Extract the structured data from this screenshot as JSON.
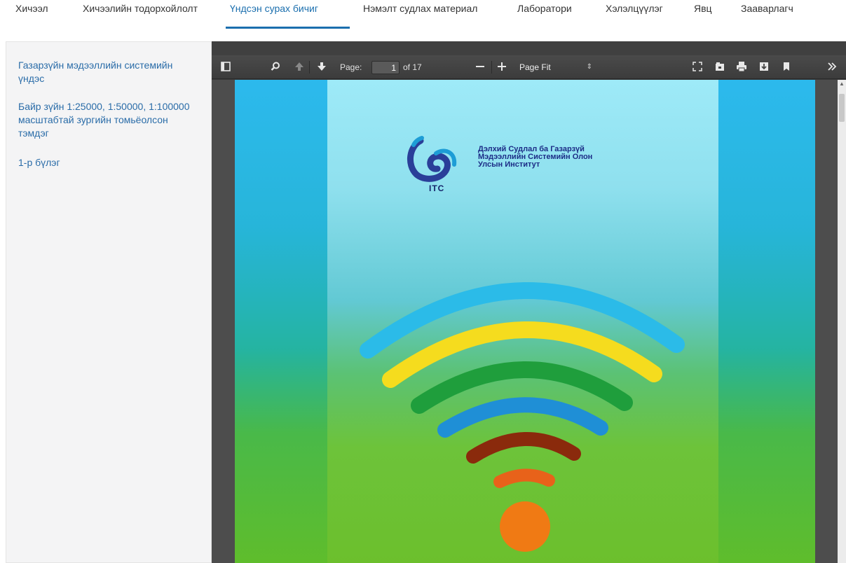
{
  "nav": {
    "tabs": [
      {
        "label": "Хичээл"
      },
      {
        "label": "Хичээлийн тодорхойлолт"
      },
      {
        "label": "Үндсэн сурах бичиг"
      },
      {
        "label": "Нэмэлт судлах материал"
      },
      {
        "label": "Лаборатори"
      },
      {
        "label": "Хэлэлцүүлэг"
      },
      {
        "label": "Явц"
      },
      {
        "label": "Зааварлагч"
      }
    ],
    "active_tab": "Үндсэн сурах бичиг"
  },
  "sidebar": {
    "items": [
      {
        "label": "Газарзүйн мэдээллийн системийн үндэс"
      },
      {
        "label": "Байр зүйн 1:25000, 1:50000, 1:100000 масштабтай зургийн томьёолсон тэмдэг"
      },
      {
        "label": "1-р бүлэг"
      }
    ]
  },
  "viewer": {
    "page_label": "Page:",
    "page_value": "1",
    "page_total": "of 17",
    "zoom_value": "Page Fit",
    "icons": [
      "sidebar-toggle-icon",
      "search-icon",
      "previous-page-icon",
      "next-page-icon",
      "zoom-out-icon",
      "zoom-in-icon",
      "presentation-mode-icon",
      "open-file-icon",
      "print-icon",
      "download-icon",
      "bookmark-icon",
      "tools-icon"
    ]
  },
  "document": {
    "logo_text": "ITC",
    "institute_lines": [
      "Дэлхий Судлал ба Газарзүй",
      "Мэдээллийн Системийн Олон",
      "Улсын Институт"
    ]
  },
  "colors": {
    "accent": "#1b6fae",
    "link": "#2a6ca8",
    "toolbar": "#404040",
    "wifi_arcs": [
      "#2bbbe8",
      "#f5dc1e",
      "#1f9e3c",
      "#1f8fd6",
      "#8a2a0c",
      "#e8621a",
      "#f07a14"
    ]
  }
}
